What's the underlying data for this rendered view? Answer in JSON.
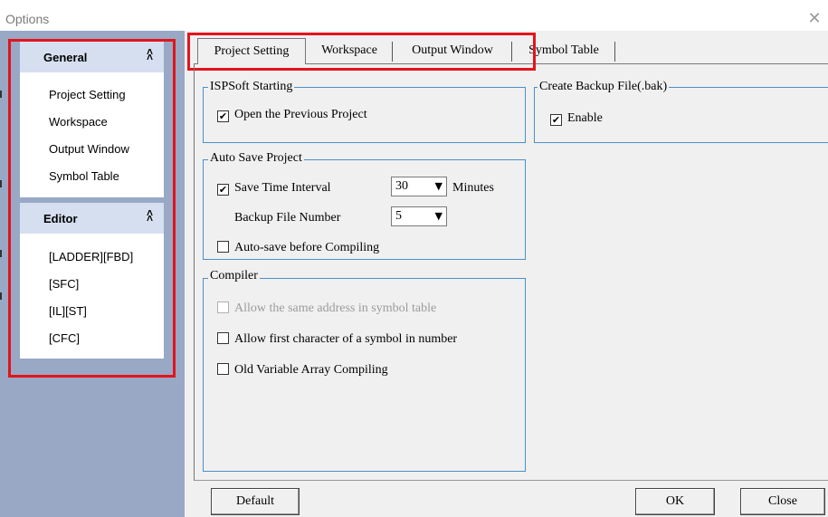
{
  "window": {
    "title": "Options",
    "close_glyph": "✕"
  },
  "sidebar": {
    "general": {
      "header": "General",
      "items": [
        "Project Setting",
        "Workspace",
        "Output Window",
        "Symbol Table"
      ]
    },
    "editor": {
      "header": "Editor",
      "items": [
        "[LADDER][FBD]",
        "[SFC]",
        "[IL][ST]",
        "[CFC]"
      ]
    },
    "collapse_glyph": "≈"
  },
  "tabs": [
    "Project Setting",
    "Workspace",
    "Output Window",
    "Symbol Table"
  ],
  "active_tab": "Project Setting",
  "groups": {
    "ispsoft_starting": {
      "title": "ISPSoft Starting",
      "open_previous": {
        "label": "Open the Previous Project",
        "checked": true
      }
    },
    "backup": {
      "title": "Create Backup File(.bak)",
      "enable": {
        "label": "Enable",
        "checked": true
      }
    },
    "auto_save": {
      "title": "Auto Save Project",
      "save_interval": {
        "label": "Save Time Interval",
        "checked": true,
        "value": "30",
        "unit": "Minutes"
      },
      "backup_number": {
        "label": "Backup File Number",
        "value": "5"
      },
      "before_compiling": {
        "label": "Auto-save before Compiling",
        "checked": false
      }
    },
    "compiler": {
      "title": "Compiler",
      "same_address": {
        "label": "Allow the same address in symbol table",
        "checked": false,
        "disabled": true
      },
      "first_char": {
        "label": "Allow first character of a symbol in number",
        "checked": false
      },
      "old_array": {
        "label": "Old Variable Array Compiling",
        "checked": false
      }
    }
  },
  "buttons": {
    "default": "Default",
    "ok": "OK",
    "close": "Close"
  },
  "check_glyph": "✔",
  "dropdown_glyph": "▼",
  "colors": {
    "highlight": "#e3141b",
    "sidebar": "#98a8c5",
    "group_border": "#4a90c8"
  }
}
